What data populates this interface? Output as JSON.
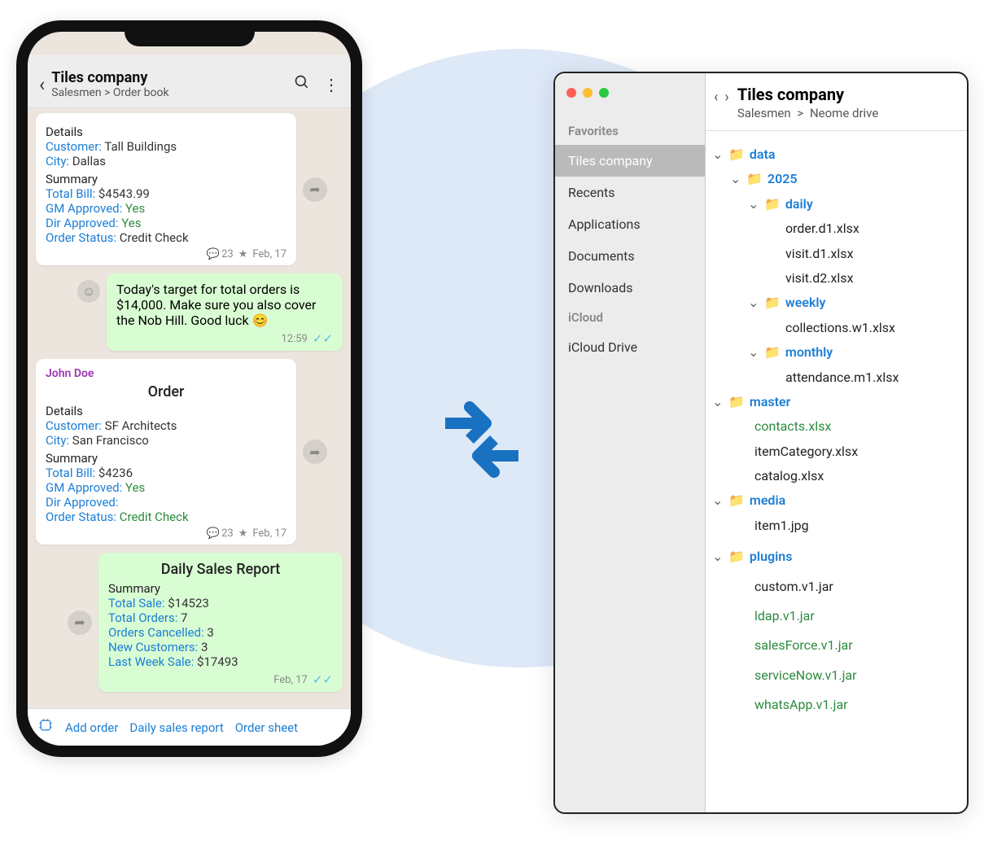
{
  "phone": {
    "header": {
      "title": "Tiles company",
      "breadcrumb": "Salesmen > Order book"
    },
    "msg1": {
      "details_label": "Details",
      "customer_k": "Customer:",
      "customer_v": "Tall Buildings",
      "city_k": "City:",
      "city_v": "Dallas",
      "summary_label": "Summary",
      "total_k": "Total Bill:",
      "total_v": "$4543.99",
      "gm_k": "GM Approved:",
      "gm_v": "Yes",
      "dir_k": "Dir Approved:",
      "dir_v": "Yes",
      "status_k": "Order Status:",
      "status_v": "Credit Check",
      "count": "23",
      "date": "Feb, 17"
    },
    "msg2": {
      "text": "Today's target for total orders is $14,000. Make sure you also cover the Nob Hill. Good luck 😊",
      "time": "12:59"
    },
    "msg3": {
      "sender": "John Doe",
      "title": "Order",
      "details_label": "Details",
      "customer_k": "Customer:",
      "customer_v": "SF Architects",
      "city_k": "City:",
      "city_v": "San Francisco",
      "summary_label": "Summary",
      "total_k": "Total Bill:",
      "total_v": "$4236",
      "gm_k": "GM Approved:",
      "gm_v": "Yes",
      "dir_k": "Dir Approved:",
      "dir_v": "",
      "status_k": "Order Status:",
      "status_v": "Credit Check",
      "count": "23",
      "date": "Feb, 17"
    },
    "msg4": {
      "title": "Daily Sales Report",
      "summary_label": "Summary",
      "sale_k": "Total Sale:",
      "sale_v": "$14523",
      "orders_k": "Total Orders:",
      "orders_v": "7",
      "cancel_k": "Orders Cancelled:",
      "cancel_v": "3",
      "new_k": "New Customers:",
      "new_v": "3",
      "last_k": "Last Week Sale:",
      "last_v": "$17493",
      "date": "Feb, 17"
    },
    "footer": {
      "a": "Add order",
      "b": "Daily sales report",
      "c": "Order sheet"
    }
  },
  "finder": {
    "header": {
      "title": "Tiles company",
      "bc1": "Salesmen",
      "sep": ">",
      "bc2": "Neome drive"
    },
    "sidebar": {
      "favorites_label": "Favorites",
      "items": [
        {
          "label": "Tiles company"
        },
        {
          "label": "Recents"
        },
        {
          "label": "Applications"
        },
        {
          "label": "Documents"
        },
        {
          "label": "Downloads"
        }
      ],
      "icloud_label": "iCloud",
      "icloud_item": "iCloud Drive"
    },
    "tree": {
      "data": "data",
      "y2025": "2025",
      "daily": "daily",
      "f1": "order.d1.xlsx",
      "f2": "visit.d1.xlsx",
      "f3": "visit.d2.xlsx",
      "weekly": "weekly",
      "f4": "collections.w1.xlsx",
      "monthly": "monthly",
      "f5": "attendance.m1.xlsx",
      "master": "master",
      "f6": "contacts.xlsx",
      "f7": "itemCategory.xlsx",
      "f8": "catalog.xlsx",
      "media": "media",
      "f9": "item1.jpg",
      "plugins": "plugins",
      "p1": "custom.v1.jar",
      "p2": "ldap.v1.jar",
      "p3": "salesForce.v1.jar",
      "p4": "serviceNow.v1.jar",
      "p5": "whatsApp.v1.jar"
    }
  }
}
